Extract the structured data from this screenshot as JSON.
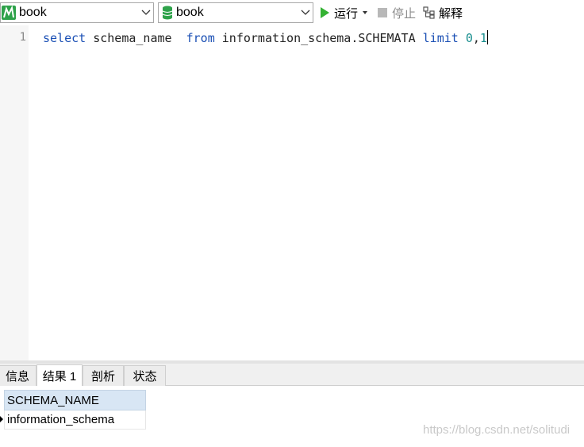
{
  "toolbar": {
    "connection_value": "book",
    "database_value": "book",
    "run_label": "运行",
    "stop_label": "停止",
    "explain_label": "解释"
  },
  "editor": {
    "line_number": "1",
    "tokens": {
      "select": "select",
      "col": " schema_name  ",
      "from": "from",
      "table": " information_schema.SCHEMATA ",
      "limit": "limit",
      "space": " ",
      "num1": "0",
      "comma": ",",
      "num2": "1"
    }
  },
  "tabs": [
    {
      "label": "信息"
    },
    {
      "label": "结果 1"
    },
    {
      "label": "剖析"
    },
    {
      "label": "状态"
    }
  ],
  "result": {
    "columns": [
      "SCHEMA_NAME"
    ],
    "rows": [
      [
        "information_schema"
      ]
    ]
  },
  "watermark": "https://blog.csdn.net/solitudi",
  "colors": {
    "keyword": "#1a4fb4",
    "number": "#1a8f8f",
    "run_green": "#34b233",
    "header_bg": "#d8e6f4"
  },
  "icons": {
    "connection": "mysql-connection-icon",
    "database": "database-icon",
    "run": "play-icon",
    "stop": "stop-icon",
    "explain": "explain-icon"
  }
}
